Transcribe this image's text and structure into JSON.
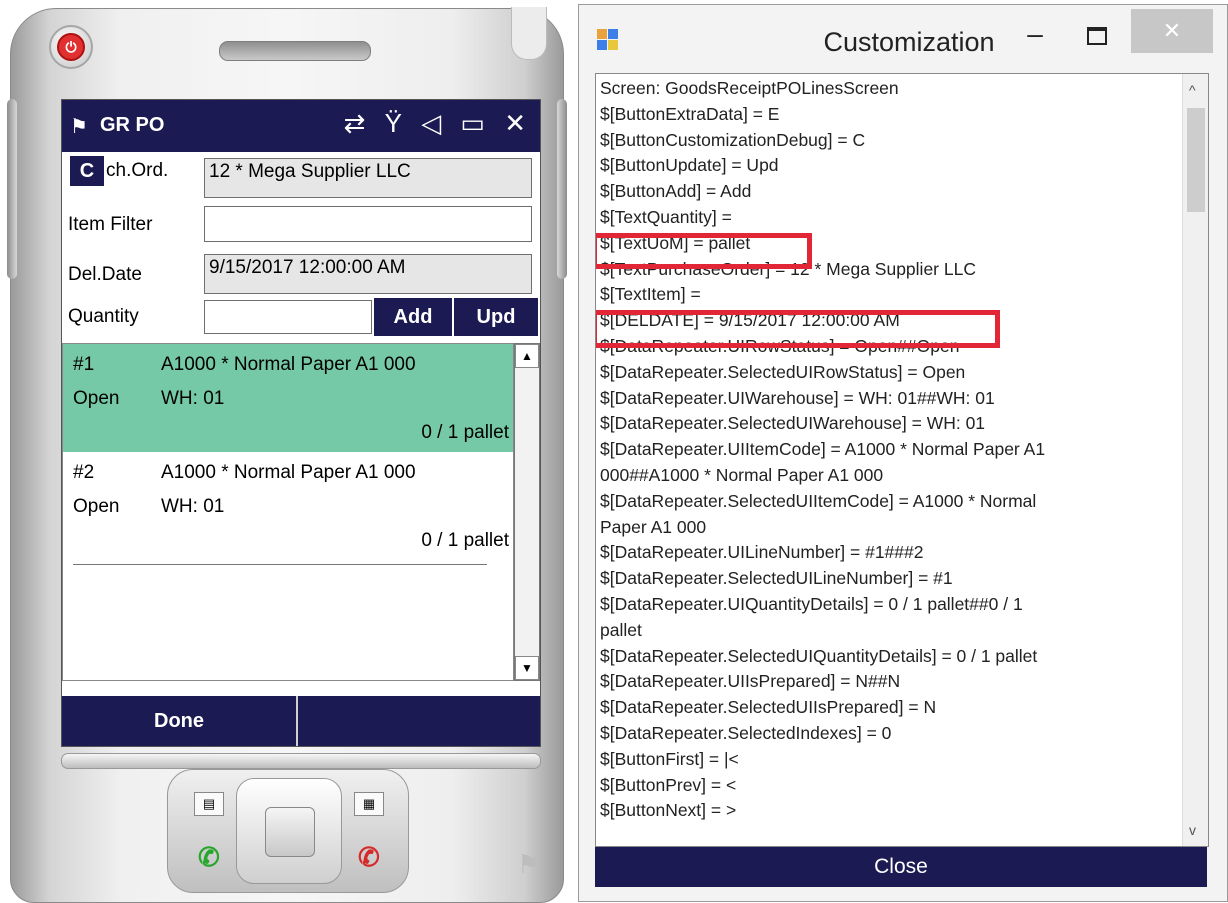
{
  "device": {
    "title": "GR PO",
    "status_icons": "⇄ Ÿ ◁ ▭ ✕",
    "c_button": "C",
    "fields": {
      "purch_ord_label": "ch.Ord.",
      "purch_ord_value": "12 * Mega Supplier LLC",
      "item_filter_label": "Item Filter",
      "item_filter_value": "",
      "del_date_label": "Del.Date",
      "del_date_value": "9/15/2017 12:00:00 AM",
      "quantity_label": "Quantity",
      "quantity_value": ""
    },
    "add_label": "Add",
    "upd_label": "Upd",
    "rows": [
      {
        "num": "#1",
        "item": "A1000 * Normal Paper A1 000",
        "status": "Open",
        "wh": "WH: 01",
        "qty": "0 / 1 pallet"
      },
      {
        "num": "#2",
        "item": "A1000 * Normal Paper A1 000",
        "status": "Open",
        "wh": "WH: 01",
        "qty": "0 / 1 pallet"
      }
    ],
    "done_label": "Done"
  },
  "customization": {
    "title": "Customization",
    "lines": [
      "Screen: GoodsReceiptPOLinesScreen",
      "$[ButtonExtraData] = E",
      "$[ButtonCustomizationDebug] = C",
      "$[ButtonUpdate] = Upd",
      "$[ButtonAdd] = Add",
      "$[TextQuantity] =",
      "$[TextUoM] = pallet",
      "$[TextPurchaseOrder] = 12 * Mega Supplier LLC",
      "$[TextItem] =",
      "$[DELDATE] = 9/15/2017 12:00:00 AM",
      "$[DataRepeater.UIRowStatus] = Open##Open",
      "$[DataRepeater.SelectedUIRowStatus] = Open",
      "$[DataRepeater.UIWarehouse] = WH: 01##WH: 01",
      "$[DataRepeater.SelectedUIWarehouse] = WH: 01",
      "$[DataRepeater.UIItemCode] = A1000 * Normal Paper A1",
      "000##A1000 * Normal Paper A1 000",
      "$[DataRepeater.SelectedUIItemCode] = A1000 * Normal",
      "Paper A1 000",
      "$[DataRepeater.UILineNumber] = #1###2",
      "$[DataRepeater.SelectedUILineNumber] = #1",
      "$[DataRepeater.UIQuantityDetails] = 0 / 1 pallet##0 / 1",
      "pallet",
      "$[DataRepeater.SelectedUIQuantityDetails] = 0 / 1 pallet",
      "$[DataRepeater.UIIsPrepared] = N##N",
      "$[DataRepeater.SelectedUIIsPrepared] = N",
      "$[DataRepeater.SelectedIndexes] = 0",
      "$[ButtonFirst] = |<",
      "$[ButtonPrev] = <",
      "$[ButtonNext] = >"
    ],
    "close_label": "Close",
    "highlight_color": "#e32636"
  }
}
